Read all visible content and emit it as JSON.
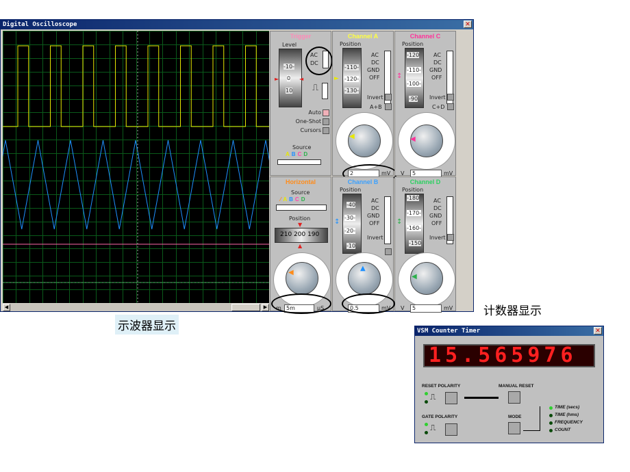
{
  "oscilloscope": {
    "title": "Digital Oscilloscope",
    "close_label": "✕",
    "trigger": {
      "header": "Trigger",
      "level_label": "Level",
      "ac": "AC",
      "dc": "DC",
      "level_ticks": [
        "-10-",
        "0",
        "10"
      ],
      "auto": "Auto",
      "one_shot": "One-Shot",
      "cursors": "Cursors",
      "source": "Source",
      "source_letters": [
        "A",
        "B",
        "C",
        "D"
      ]
    },
    "channel_a": {
      "header": "Channel A",
      "position": "Position",
      "ticks": [
        "-110-",
        "-120-",
        "-130-"
      ],
      "modes": [
        "AC",
        "DC",
        "GND",
        "OFF"
      ],
      "invert": "Invert",
      "sum": "A+B",
      "value": "2",
      "unit": "mV"
    },
    "channel_c": {
      "header": "Channel C",
      "position": "Position",
      "ticks": [
        "-120",
        "-110-",
        "-100-",
        "-90"
      ],
      "modes": [
        "AC",
        "DC",
        "GND",
        "OFF"
      ],
      "invert": "Invert",
      "sum": "C+D",
      "unit_left": "V",
      "value": "5",
      "unit": "mV"
    },
    "horizontal": {
      "header": "Horizontal",
      "source": "Source",
      "source_letters": [
        "A",
        "B",
        "C",
        "D"
      ],
      "position": "Position",
      "readout": "210 200 190",
      "value": "5m",
      "unit": "μS",
      "unit_left": "m"
    },
    "channel_b": {
      "header": "Channel B",
      "position": "Position",
      "ticks": [
        "-40",
        "-30-",
        "-20-",
        "-10"
      ],
      "modes": [
        "AC",
        "DC",
        "GND",
        "OFF"
      ],
      "invert": "Invert",
      "value": "0.5",
      "unit": "mV"
    },
    "channel_d": {
      "header": "Channel D",
      "position": "Position",
      "ticks": [
        "-180",
        "-170-",
        "-160-",
        "-150"
      ],
      "modes": [
        "AC",
        "DC",
        "GND",
        "OFF"
      ],
      "invert": "Invert",
      "unit_left": "V",
      "value": "5",
      "unit": "mV"
    },
    "dial_scale_small": [
      "0.5",
      "0.2",
      "0.1",
      "1",
      "50",
      "2",
      "20",
      "5",
      "10",
      "10",
      "5",
      "20",
      "2"
    ],
    "colors": {
      "trace_a": "#e8e800",
      "trace_b": "#1e90ff",
      "trace_c": "#ff66aa",
      "trace_d": "#2bb04a",
      "grid": "#0a5a1a"
    }
  },
  "captions": {
    "scope": "示波器显示",
    "counter": "计数器显示"
  },
  "counter": {
    "title": "VSM Counter Timer",
    "close_label": "✕",
    "display": "15.565976",
    "reset_polarity": "RESET POLARITY",
    "manual_reset": "MANUAL RESET",
    "gate_polarity": "GATE POLARITY",
    "mode": "MODE",
    "modes": [
      "TIME (secs)",
      "TIME (hms)",
      "FREQUENCY",
      "COUNT"
    ]
  }
}
